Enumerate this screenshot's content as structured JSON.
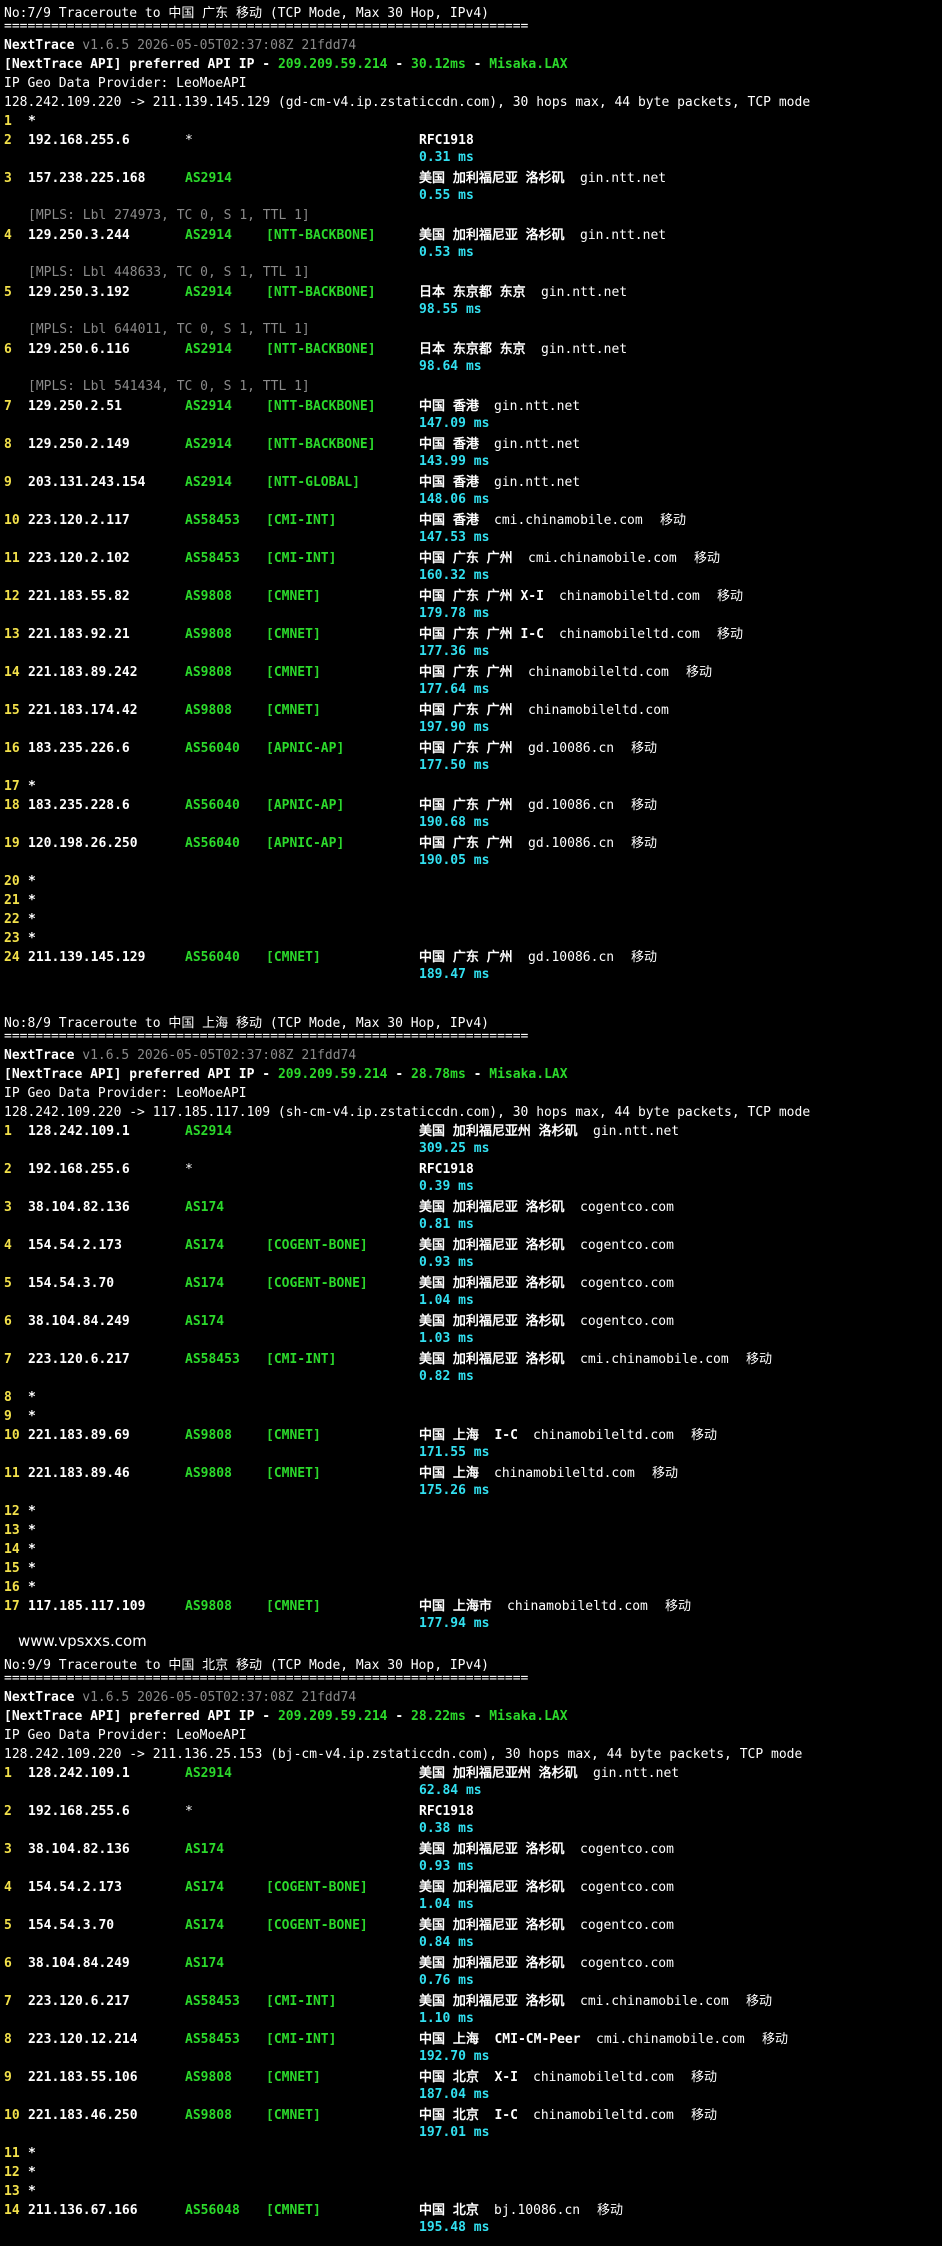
{
  "watermark": "www.vpsxxs.com",
  "sections": [
    {
      "title": "No:7/9 Traceroute to 中国 广东 移动 (TCP Mode, Max 30 Hop, IPv4)",
      "sep": "===================================================================",
      "nt_name": "NextTrace",
      "nt_version": "v1.6.5 2026-05-05T02:37:08Z 21fdd74",
      "api_pre": "[NextTrace API] preferred API IP - ",
      "api_ip": "209.209.59.214",
      "api_dash": " - ",
      "api_ms": "30.12ms",
      "api_node": "Misaka.LAX",
      "geo": "IP Geo Data Provider: LeoMoeAPI",
      "route": "128.242.109.220 -> 211.139.145.129 (gd-cm-v4.ip.zstaticcdn.com), 30 hops max, 44 byte packets, TCP mode",
      "hops": [
        {
          "n": "1",
          "star": true
        },
        {
          "n": "2",
          "ip": "192.168.255.6",
          "as": "*",
          "tag": "",
          "geo": "RFC1918",
          "host": "",
          "isp": "",
          "ms": "0.31 ms"
        },
        {
          "n": "3",
          "ip": "157.238.225.168",
          "as": "AS2914",
          "tag": "",
          "geo": "美国 加利福尼亚 洛杉矶",
          "host": "gin.ntt.net",
          "isp": "",
          "ms": "0.55 ms"
        },
        {
          "n": "4",
          "ip": "129.250.3.244",
          "as": "AS2914",
          "tag": "[NTT-BACKBONE]",
          "geo": "美国 加利福尼亚 洛杉矶",
          "host": "gin.ntt.net",
          "isp": "",
          "ms": "0.53 ms",
          "mpls": "[MPLS: Lbl 274973, TC 0, S 1, TTL 1]"
        },
        {
          "n": "5",
          "ip": "129.250.3.192",
          "as": "AS2914",
          "tag": "[NTT-BACKBONE]",
          "geo": "日本 东京都 东京",
          "host": "gin.ntt.net",
          "isp": "",
          "ms": "98.55 ms",
          "mpls": "[MPLS: Lbl 448633, TC 0, S 1, TTL 1]"
        },
        {
          "n": "6",
          "ip": "129.250.6.116",
          "as": "AS2914",
          "tag": "[NTT-BACKBONE]",
          "geo": "日本 东京都 东京",
          "host": "gin.ntt.net",
          "isp": "",
          "ms": "98.64 ms",
          "mpls": "[MPLS: Lbl 644011, TC 0, S 1, TTL 1]"
        },
        {
          "n": "7",
          "ip": "129.250.2.51",
          "as": "AS2914",
          "tag": "[NTT-BACKBONE]",
          "geo": "中国 香港",
          "host": "gin.ntt.net",
          "isp": "",
          "ms": "147.09 ms",
          "mpls": "[MPLS: Lbl 541434, TC 0, S 1, TTL 1]"
        },
        {
          "n": "8",
          "ip": "129.250.2.149",
          "as": "AS2914",
          "tag": "[NTT-BACKBONE]",
          "geo": "中国 香港",
          "host": "gin.ntt.net",
          "isp": "",
          "ms": "143.99 ms"
        },
        {
          "n": "9",
          "ip": "203.131.243.154",
          "as": "AS2914",
          "tag": "[NTT-GLOBAL]",
          "geo": "中国 香港",
          "host": "gin.ntt.net",
          "isp": "",
          "ms": "148.06 ms"
        },
        {
          "n": "10",
          "ip": "223.120.2.117",
          "as": "AS58453",
          "tag": "[CMI-INT]",
          "geo": "中国 香港",
          "host": "cmi.chinamobile.com",
          "isp": "移动",
          "ms": "147.53 ms"
        },
        {
          "n": "11",
          "ip": "223.120.2.102",
          "as": "AS58453",
          "tag": "[CMI-INT]",
          "geo": "中国 广东 广州",
          "host": "cmi.chinamobile.com",
          "isp": "移动",
          "ms": "160.32 ms"
        },
        {
          "n": "12",
          "ip": "221.183.55.82",
          "as": "AS9808",
          "tag": "[CMNET]",
          "geo": "中国 广东 广州 X-I",
          "host": "chinamobileltd.com",
          "isp": "移动",
          "ms": "179.78 ms"
        },
        {
          "n": "13",
          "ip": "221.183.92.21",
          "as": "AS9808",
          "tag": "[CMNET]",
          "geo": "中国 广东 广州 I-C",
          "host": "chinamobileltd.com",
          "isp": "移动",
          "ms": "177.36 ms"
        },
        {
          "n": "14",
          "ip": "221.183.89.242",
          "as": "AS9808",
          "tag": "[CMNET]",
          "geo": "中国 广东 广州",
          "host": "chinamobileltd.com",
          "isp": "移动",
          "ms": "177.64 ms"
        },
        {
          "n": "15",
          "ip": "221.183.174.42",
          "as": "AS9808",
          "tag": "[CMNET]",
          "geo": "中国 广东 广州",
          "host": "chinamobileltd.com",
          "isp": "",
          "ms": "197.90 ms"
        },
        {
          "n": "16",
          "ip": "183.235.226.6",
          "as": "AS56040",
          "tag": "[APNIC-AP]",
          "geo": "中国 广东 广州",
          "host": "gd.10086.cn",
          "isp": "移动",
          "ms": "177.50 ms"
        },
        {
          "n": "17",
          "star": true
        },
        {
          "n": "18",
          "ip": "183.235.228.6",
          "as": "AS56040",
          "tag": "[APNIC-AP]",
          "geo": "中国 广东 广州",
          "host": "gd.10086.cn",
          "isp": "移动",
          "ms": "190.68 ms"
        },
        {
          "n": "19",
          "ip": "120.198.26.250",
          "as": "AS56040",
          "tag": "[APNIC-AP]",
          "geo": "中国 广东 广州",
          "host": "gd.10086.cn",
          "isp": "移动",
          "ms": "190.05 ms"
        },
        {
          "n": "20",
          "star": true
        },
        {
          "n": "21",
          "star": true
        },
        {
          "n": "22",
          "star": true
        },
        {
          "n": "23",
          "star": true
        },
        {
          "n": "24",
          "ip": "211.139.145.129",
          "as": "AS56040",
          "tag": "[CMNET]",
          "geo": "中国 广东 广州",
          "host": "gd.10086.cn",
          "isp": "移动",
          "ms": "189.47 ms"
        }
      ]
    },
    {
      "title": "No:8/9 Traceroute to 中国 上海 移动 (TCP Mode, Max 30 Hop, IPv4)",
      "sep": "===================================================================",
      "nt_name": "NextTrace",
      "nt_version": "v1.6.5 2026-05-05T02:37:08Z 21fdd74",
      "api_pre": "[NextTrace API] preferred API IP - ",
      "api_ip": "209.209.59.214",
      "api_dash": " - ",
      "api_ms": "28.78ms",
      "api_node": "Misaka.LAX",
      "geo": "IP Geo Data Provider: LeoMoeAPI",
      "route": "128.242.109.220 -> 117.185.117.109 (sh-cm-v4.ip.zstaticcdn.com), 30 hops max, 44 byte packets, TCP mode",
      "hops": [
        {
          "n": "1",
          "ip": "128.242.109.1",
          "as": "AS2914",
          "tag": "",
          "geo": "美国 加利福尼亚州 洛杉矶",
          "host": "gin.ntt.net",
          "isp": "",
          "ms": "309.25 ms"
        },
        {
          "n": "2",
          "ip": "192.168.255.6",
          "as": "*",
          "tag": "",
          "geo": "RFC1918",
          "host": "",
          "isp": "",
          "ms": "0.39 ms"
        },
        {
          "n": "3",
          "ip": "38.104.82.136",
          "as": "AS174",
          "tag": "",
          "geo": "美国 加利福尼亚 洛杉矶",
          "host": "cogentco.com",
          "isp": "",
          "ms": "0.81 ms"
        },
        {
          "n": "4",
          "ip": "154.54.2.173",
          "as": "AS174",
          "tag": "[COGENT-BONE]",
          "geo": "美国 加利福尼亚 洛杉矶",
          "host": "cogentco.com",
          "isp": "",
          "ms": "0.93 ms"
        },
        {
          "n": "5",
          "ip": "154.54.3.70",
          "as": "AS174",
          "tag": "[COGENT-BONE]",
          "geo": "美国 加利福尼亚 洛杉矶",
          "host": "cogentco.com",
          "isp": "",
          "ms": "1.04 ms"
        },
        {
          "n": "6",
          "ip": "38.104.84.249",
          "as": "AS174",
          "tag": "",
          "geo": "美国 加利福尼亚 洛杉矶",
          "host": "cogentco.com",
          "isp": "",
          "ms": "1.03 ms"
        },
        {
          "n": "7",
          "ip": "223.120.6.217",
          "as": "AS58453",
          "tag": "[CMI-INT]",
          "geo": "美国 加利福尼亚 洛杉矶",
          "host": "cmi.chinamobile.com",
          "isp": "移动",
          "ms": "0.82 ms"
        },
        {
          "n": "8",
          "star": true
        },
        {
          "n": "9",
          "star": true
        },
        {
          "n": "10",
          "ip": "221.183.89.69",
          "as": "AS9808",
          "tag": "[CMNET]",
          "geo": "中国 上海  I-C",
          "host": "chinamobileltd.com",
          "isp": "移动",
          "ms": "171.55 ms"
        },
        {
          "n": "11",
          "ip": "221.183.89.46",
          "as": "AS9808",
          "tag": "[CMNET]",
          "geo": "中国 上海",
          "host": "chinamobileltd.com",
          "isp": "移动",
          "ms": "175.26 ms"
        },
        {
          "n": "12",
          "star": true
        },
        {
          "n": "13",
          "star": true
        },
        {
          "n": "14",
          "star": true
        },
        {
          "n": "15",
          "star": true
        },
        {
          "n": "16",
          "star": true
        },
        {
          "n": "17",
          "ip": "117.185.117.109",
          "as": "AS9808",
          "tag": "[CMNET]",
          "geo": "中国 上海市",
          "host": "chinamobileltd.com",
          "isp": "移动",
          "ms": "177.94 ms"
        }
      ]
    },
    {
      "title": "No:9/9 Traceroute to 中国 北京 移动 (TCP Mode, Max 30 Hop, IPv4)",
      "sep": "===================================================================",
      "nt_name": "NextTrace",
      "nt_version": "v1.6.5 2026-05-05T02:37:08Z 21fdd74",
      "api_pre": "[NextTrace API] preferred API IP - ",
      "api_ip": "209.209.59.214",
      "api_dash": " - ",
      "api_ms": "28.22ms",
      "api_node": "Misaka.LAX",
      "geo": "IP Geo Data Provider: LeoMoeAPI",
      "route": "128.242.109.220 -> 211.136.25.153 (bj-cm-v4.ip.zstaticcdn.com), 30 hops max, 44 byte packets, TCP mode",
      "hops": [
        {
          "n": "1",
          "ip": "128.242.109.1",
          "as": "AS2914",
          "tag": "",
          "geo": "美国 加利福尼亚州 洛杉矶",
          "host": "gin.ntt.net",
          "isp": "",
          "ms": "62.84 ms"
        },
        {
          "n": "2",
          "ip": "192.168.255.6",
          "as": "*",
          "tag": "",
          "geo": "RFC1918",
          "host": "",
          "isp": "",
          "ms": "0.38 ms"
        },
        {
          "n": "3",
          "ip": "38.104.82.136",
          "as": "AS174",
          "tag": "",
          "geo": "美国 加利福尼亚 洛杉矶",
          "host": "cogentco.com",
          "isp": "",
          "ms": "0.93 ms"
        },
        {
          "n": "4",
          "ip": "154.54.2.173",
          "as": "AS174",
          "tag": "[COGENT-BONE]",
          "geo": "美国 加利福尼亚 洛杉矶",
          "host": "cogentco.com",
          "isp": "",
          "ms": "1.04 ms"
        },
        {
          "n": "5",
          "ip": "154.54.3.70",
          "as": "AS174",
          "tag": "[COGENT-BONE]",
          "geo": "美国 加利福尼亚 洛杉矶",
          "host": "cogentco.com",
          "isp": "",
          "ms": "0.84 ms"
        },
        {
          "n": "6",
          "ip": "38.104.84.249",
          "as": "AS174",
          "tag": "",
          "geo": "美国 加利福尼亚 洛杉矶",
          "host": "cogentco.com",
          "isp": "",
          "ms": "0.76 ms"
        },
        {
          "n": "7",
          "ip": "223.120.6.217",
          "as": "AS58453",
          "tag": "[CMI-INT]",
          "geo": "美国 加利福尼亚 洛杉矶",
          "host": "cmi.chinamobile.com",
          "isp": "移动",
          "ms": "1.10 ms"
        },
        {
          "n": "8",
          "ip": "223.120.12.214",
          "as": "AS58453",
          "tag": "[CMI-INT]",
          "geo": "中国 上海  CMI-CM-Peer",
          "host": "cmi.chinamobile.com",
          "isp": "移动",
          "ms": "192.70 ms"
        },
        {
          "n": "9",
          "ip": "221.183.55.106",
          "as": "AS9808",
          "tag": "[CMNET]",
          "geo": "中国 北京  X-I",
          "host": "chinamobileltd.com",
          "isp": "移动",
          "ms": "187.04 ms"
        },
        {
          "n": "10",
          "ip": "221.183.46.250",
          "as": "AS9808",
          "tag": "[CMNET]",
          "geo": "中国 北京  I-C",
          "host": "chinamobileltd.com",
          "isp": "移动",
          "ms": "197.01 ms"
        },
        {
          "n": "11",
          "star": true
        },
        {
          "n": "12",
          "star": true
        },
        {
          "n": "13",
          "star": true
        },
        {
          "n": "14",
          "ip": "211.136.67.166",
          "as": "AS56048",
          "tag": "[CMNET]",
          "geo": "中国 北京",
          "host": "bj.10086.cn",
          "isp": "移动",
          "ms": "195.48 ms"
        }
      ]
    }
  ]
}
